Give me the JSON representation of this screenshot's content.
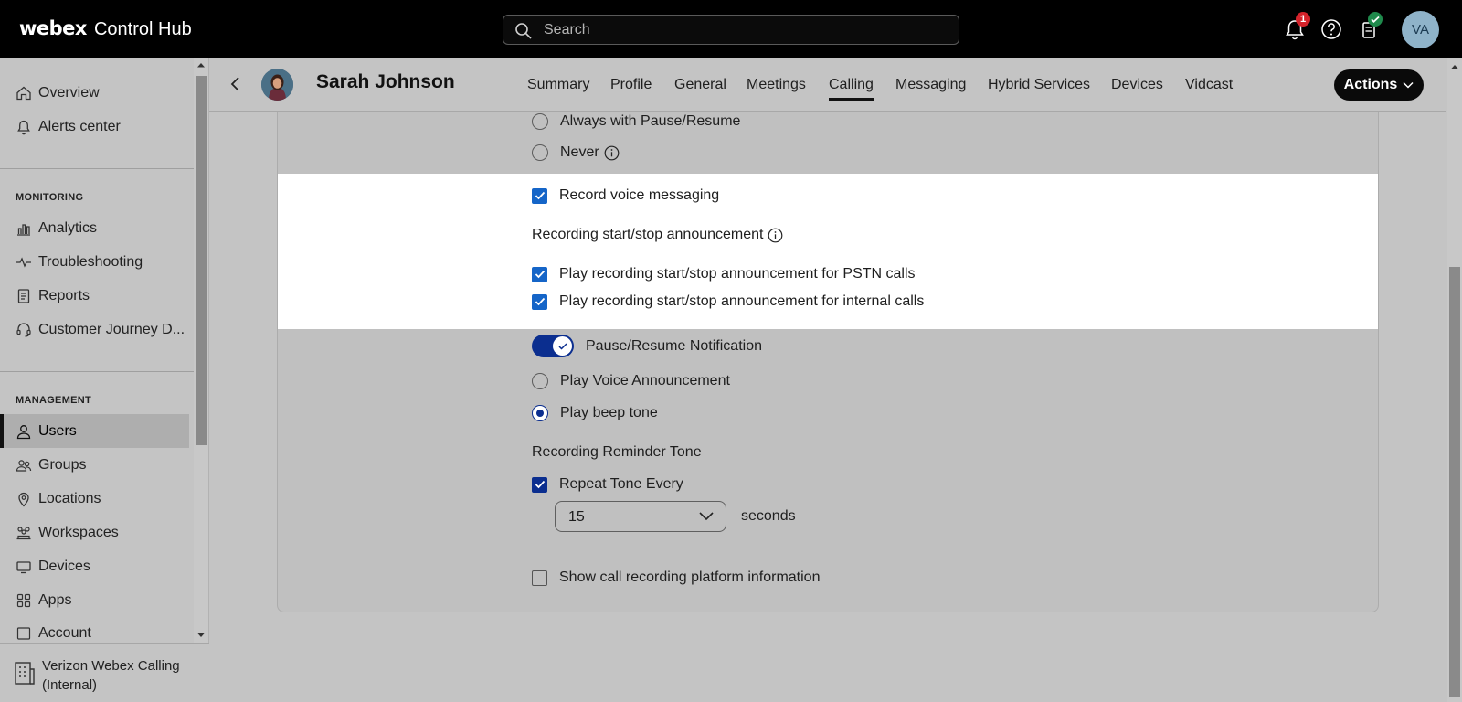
{
  "app": {
    "brand_webex": "webex",
    "brand_product": "Control Hub"
  },
  "search": {
    "placeholder": "Search"
  },
  "topbar": {
    "notification_count": "1",
    "avatar_initials": "VA"
  },
  "sidebar": {
    "items_top": [
      {
        "label": "Overview",
        "icon": "home-icon"
      },
      {
        "label": "Alerts center",
        "icon": "bell-icon"
      }
    ],
    "monitoring_title": "MONITORING",
    "monitoring": [
      {
        "label": "Analytics",
        "icon": "analytics-icon"
      },
      {
        "label": "Troubleshooting",
        "icon": "pulse-icon"
      },
      {
        "label": "Reports",
        "icon": "report-icon"
      },
      {
        "label": "Customer Journey D...",
        "icon": "headset-icon"
      }
    ],
    "management_title": "MANAGEMENT",
    "management": [
      {
        "label": "Users",
        "icon": "user-icon"
      },
      {
        "label": "Groups",
        "icon": "groups-icon"
      },
      {
        "label": "Locations",
        "icon": "location-icon"
      },
      {
        "label": "Workspaces",
        "icon": "workspaces-icon"
      },
      {
        "label": "Devices",
        "icon": "devices-icon"
      },
      {
        "label": "Apps",
        "icon": "apps-icon"
      },
      {
        "label": "Account",
        "icon": "account-icon"
      }
    ],
    "footer_line1": "Verizon Webex Calling",
    "footer_line2": "(Internal)"
  },
  "header": {
    "person_name": "Sarah Johnson",
    "tabs": [
      "Summary",
      "Profile",
      "General",
      "Meetings",
      "Calling",
      "Messaging",
      "Hybrid Services",
      "Devices",
      "Vidcast"
    ],
    "active_tab": "Calling",
    "actions_label": "Actions"
  },
  "recording": {
    "always_pause_resume": "Always with Pause/Resume",
    "never": "Never",
    "record_voice_messaging": "Record voice messaging",
    "announcement_title": "Recording start/stop announcement",
    "pstn_label": "Play recording start/stop announcement for PSTN calls",
    "internal_label": "Play recording start/stop announcement for internal calls",
    "pause_resume_notification": "Pause/Resume Notification",
    "play_voice_announcement": "Play Voice Announcement",
    "play_beep_tone": "Play beep tone",
    "reminder_title": "Recording Reminder Tone",
    "repeat_tone_every": "Repeat Tone Every",
    "repeat_value": "15",
    "seconds": "seconds",
    "show_platform_info": "Show call recording platform information"
  },
  "colors": {
    "accent": "#0b2e8f",
    "checkbox_blue": "#1565c8",
    "badge_red": "#d4232b",
    "badge_green": "#1f8a4c"
  }
}
